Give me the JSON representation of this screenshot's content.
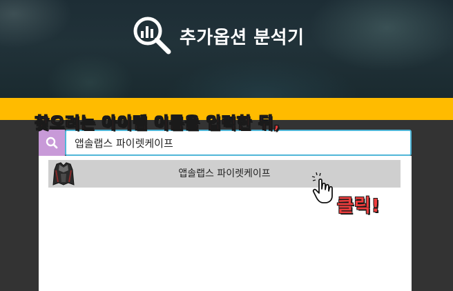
{
  "header": {
    "title": "추가옵션 분석기",
    "logo_icon": "chart-magnifier-icon"
  },
  "instruction": {
    "text": "찾으려는 아이템 이름을 입력한 뒤,",
    "color": "#ee3d3d"
  },
  "search": {
    "button_icon": "search-icon",
    "value": "앱솔랩스 파이렛케이프",
    "button_color": "#c89ad8",
    "border_color": "#4fb6d8"
  },
  "results": [
    {
      "icon": "cape-icon",
      "label": "앱솔랩스 파이렛케이프"
    }
  ],
  "hint": {
    "click_text": "클릭!",
    "cursor_icon": "hand-cursor-icon"
  },
  "colors": {
    "accent_band": "#ffbb00",
    "background": "#333333"
  }
}
